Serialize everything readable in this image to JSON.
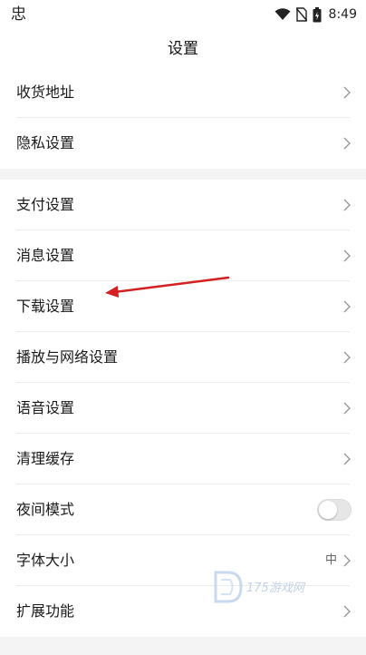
{
  "status_bar": {
    "app_icon": "忠",
    "time": "8:49",
    "icons": [
      "wifi-icon",
      "no-sim-icon",
      "battery-icon"
    ]
  },
  "header": {
    "title": "设置"
  },
  "sections": [
    {
      "items": [
        {
          "label": "收货地址",
          "type": "link"
        },
        {
          "label": "隐私设置",
          "type": "link"
        }
      ]
    },
    {
      "items": [
        {
          "label": "支付设置",
          "type": "link"
        },
        {
          "label": "消息设置",
          "type": "link"
        },
        {
          "label": "下载设置",
          "type": "link"
        },
        {
          "label": "播放与网络设置",
          "type": "link"
        },
        {
          "label": "语音设置",
          "type": "link"
        },
        {
          "label": "清理缓存",
          "type": "link"
        },
        {
          "label": "夜间模式",
          "type": "toggle",
          "on": false
        },
        {
          "label": "字体大小",
          "type": "link",
          "value": "中"
        },
        {
          "label": "扩展功能",
          "type": "link"
        }
      ]
    }
  ],
  "annotation": {
    "type": "arrow",
    "color": "#d42020",
    "points_to": "下载设置"
  },
  "watermark": {
    "text": "175游戏网"
  },
  "colors": {
    "background": "#ffffff",
    "section_gap": "#f4f4f4",
    "divider": "#ececec",
    "chevron": "#9a9a9a",
    "toggle_track": "#e6e6e6"
  }
}
